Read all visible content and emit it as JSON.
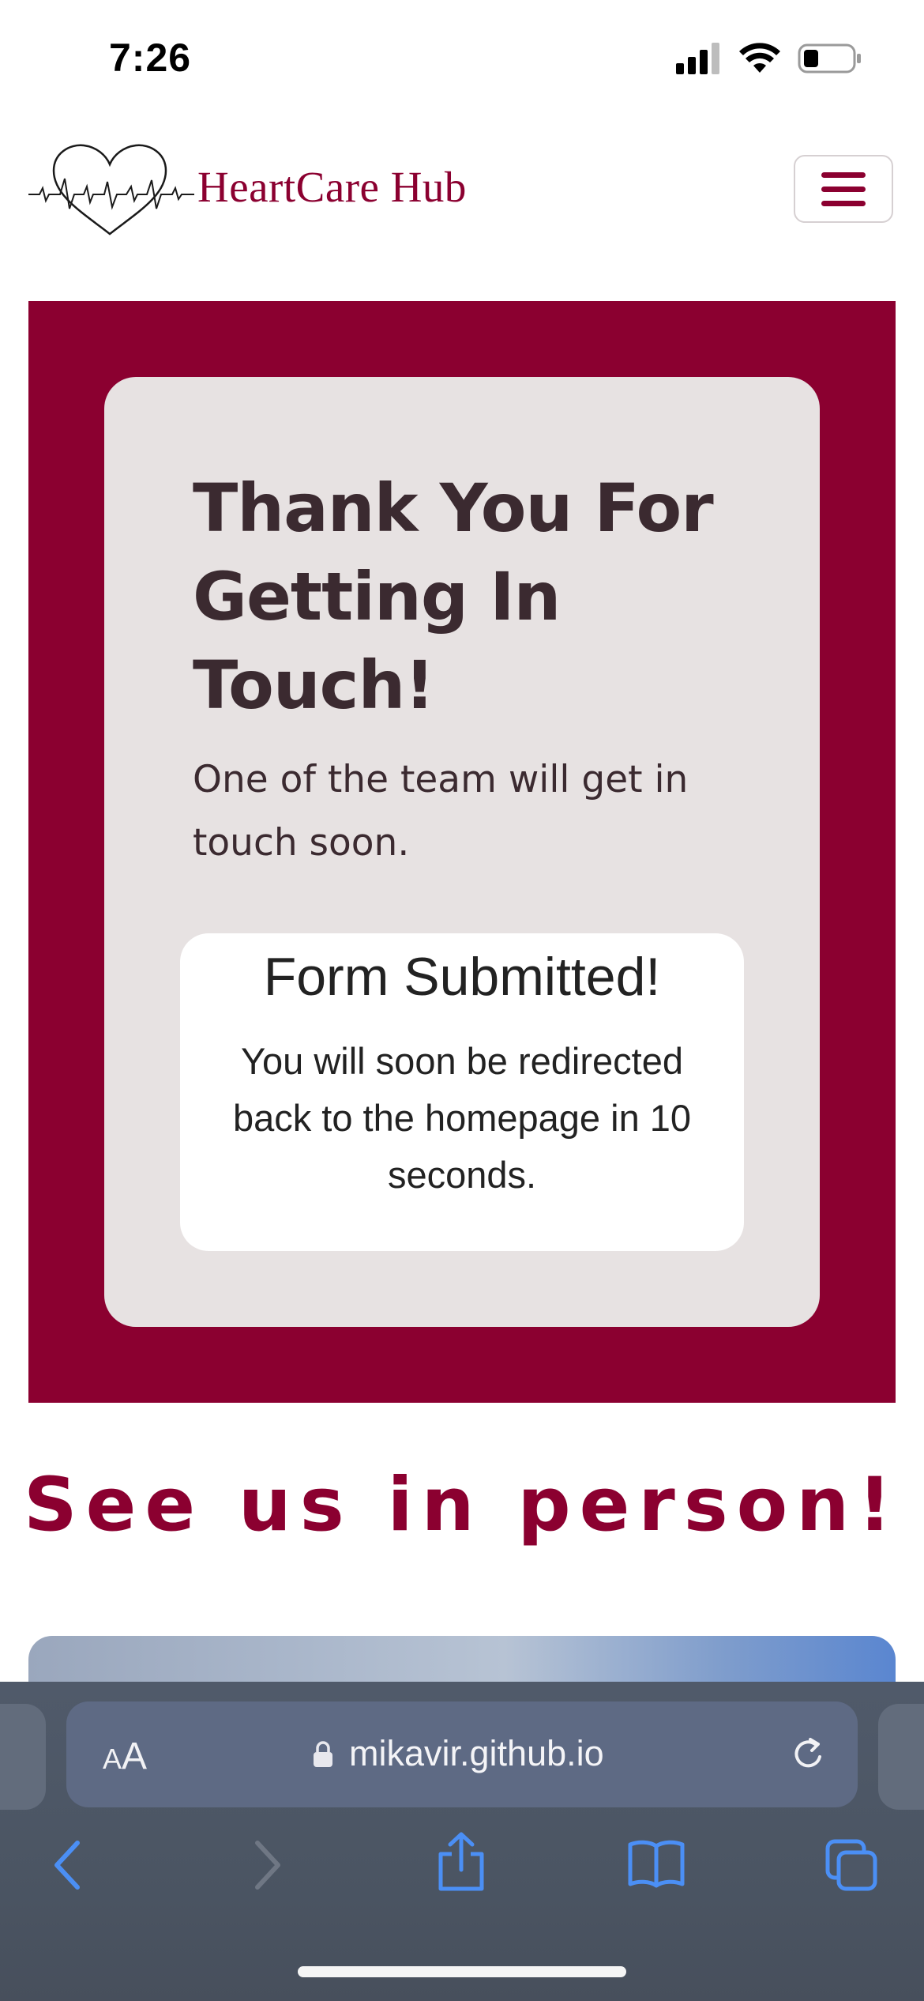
{
  "status_bar": {
    "time": "7:26"
  },
  "header": {
    "brand": "HeartCare Hub",
    "logo_icon": "heart-pulse-logo-icon",
    "menu_icon": "hamburger-icon"
  },
  "colors": {
    "brand": "#8b0030",
    "card": "#e7e2e2",
    "browser": "#4b5563"
  },
  "hero": {
    "title": "Thank You For Getting In Touch!",
    "text": "One of the team will get in touch soon.",
    "notice": {
      "title": "Form Submitted!",
      "text": "You will soon be redirected back to the homepage in 10 seconds."
    }
  },
  "location": {
    "heading": "See us in person!"
  },
  "browser": {
    "text_size_small": "A",
    "text_size_large": "A",
    "url": "mikavir.github.io",
    "toolbar_icons": [
      "back-icon",
      "forward-icon",
      "share-icon",
      "bookmarks-icon",
      "tabs-icon"
    ]
  }
}
